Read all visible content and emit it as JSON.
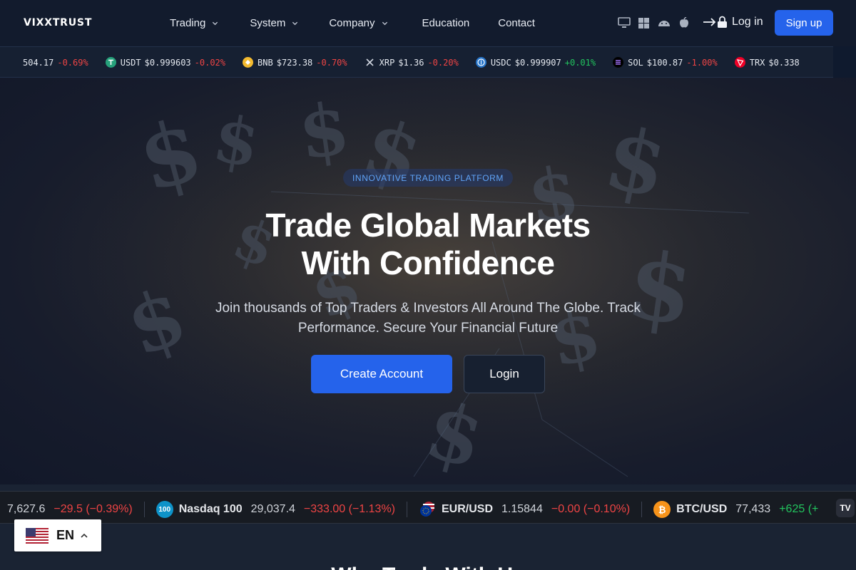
{
  "brand": {
    "name": "VIXXTRUST"
  },
  "nav": {
    "items": [
      {
        "label": "Trading",
        "has_dropdown": true
      },
      {
        "label": "System",
        "has_dropdown": true
      },
      {
        "label": "Company",
        "has_dropdown": true
      },
      {
        "label": "Education",
        "has_dropdown": false
      },
      {
        "label": "Contact",
        "has_dropdown": false
      }
    ],
    "platform_icons": [
      "desktop-icon",
      "windows-icon",
      "android-icon",
      "apple-icon"
    ],
    "login_label": "Log in",
    "signup_label": "Sign up"
  },
  "crypto_ticker": [
    {
      "symbol": "",
      "price": "504.17",
      "change": "-0.69%",
      "direction": "down",
      "icon": ""
    },
    {
      "symbol": "USDT",
      "price": "$0.999603",
      "change": "-0.02%",
      "direction": "down",
      "icon": "tether-icon"
    },
    {
      "symbol": "BNB",
      "price": "$723.38",
      "change": "-0.70%",
      "direction": "down",
      "icon": "bnb-icon"
    },
    {
      "symbol": "XRP",
      "price": "$1.36",
      "change": "-0.20%",
      "direction": "down",
      "icon": "xrp-icon"
    },
    {
      "symbol": "USDC",
      "price": "$0.999907",
      "change": "+0.01%",
      "direction": "up",
      "icon": "usdc-icon"
    },
    {
      "symbol": "SOL",
      "price": "$100.87",
      "change": "-1.00%",
      "direction": "down",
      "icon": "solana-icon"
    },
    {
      "symbol": "TRX",
      "price": "$0.338",
      "change": "",
      "direction": "down",
      "icon": "tron-icon"
    }
  ],
  "hero": {
    "badge": "INNOVATIVE TRADING PLATFORM",
    "headline_line1": "Trade Global Markets",
    "headline_line2": "With Confidence",
    "subline_line1": "Join thousands of Top Traders & Investors All Around The Globe. Track",
    "subline_line2": "Performance. Secure Your Financial Future",
    "primary_cta": "Create Account",
    "secondary_cta": "Login"
  },
  "market_ticker": [
    {
      "name": "",
      "value": "7,627.6",
      "change": "−29.5 (−0.39%)",
      "direction": "down",
      "icon": "",
      "icon_text": ""
    },
    {
      "name": "Nasdaq 100",
      "value": "29,037.4",
      "change": "−333.00 (−1.13%)",
      "direction": "down",
      "icon": "nasdaq-icon",
      "icon_text": "100"
    },
    {
      "name": "EUR/USD",
      "value": "1.15844",
      "change": "−0.00 (−0.10%)",
      "direction": "down",
      "icon": "eur-usd-icon",
      "icon_text": ""
    },
    {
      "name": "BTC/USD",
      "value": "77,433",
      "change": "+625 (+",
      "direction": "up",
      "icon": "bitcoin-icon",
      "icon_text": "₿"
    }
  ],
  "market_widget_logo": "TV",
  "below": {
    "heading": "Why Trade With Us"
  },
  "language": {
    "code": "EN"
  },
  "colors": {
    "accent": "#2563eb",
    "negative": "#ef4444",
    "positive": "#22c55e",
    "badge_text": "#60a5fa"
  }
}
